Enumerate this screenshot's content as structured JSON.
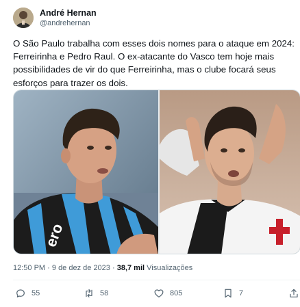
{
  "author": {
    "display_name": "André Hernan",
    "handle": "@andrehernan",
    "avatar_icon": "user-avatar-photo"
  },
  "tweet": {
    "text": "O São Paulo trabalha com esses dois nomes para o ataque em 2024: Ferreirinha e Pedro Raul. O ex-atacante do Vasco tem hoje mais possibilidades de vir do que Ferreirinha, mas o clube focará seus esforços para trazer os dois.",
    "left_photo_text": "ero",
    "time": "12:50 PM",
    "date": "9 de dez de 2023",
    "separator": "·",
    "views_count": "38,7 mil",
    "views_label": "Visualizações"
  },
  "actions": {
    "replies": "55",
    "retweets": "58",
    "likes": "805",
    "bookmarks": "7",
    "reply_icon": "reply-icon",
    "retweet_icon": "retweet-icon",
    "like_icon": "heart-icon",
    "bookmark_icon": "bookmark-icon",
    "share_icon": "share-icon"
  },
  "colors": {
    "text_primary": "#0f1419",
    "text_secondary": "#536471",
    "divider": "#eff3f4"
  }
}
